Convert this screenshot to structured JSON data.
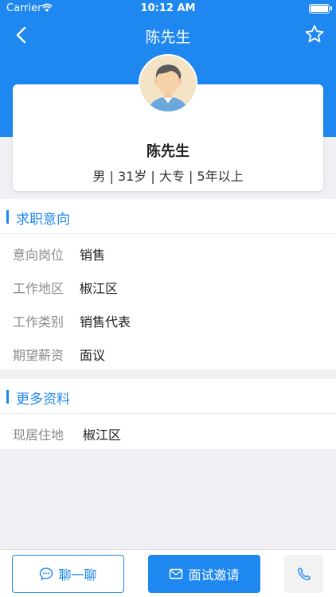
{
  "status_bar": {
    "carrier": "Carrier",
    "time": "10:12 AM"
  },
  "nav": {
    "title": "陈先生",
    "back_icon": "chevron-left-icon",
    "favorite_icon": "star-icon"
  },
  "profile": {
    "name": "陈先生",
    "meta": "男 | 31岁 | 大专 | 5年以上",
    "avatar_icon": "male-avatar-icon"
  },
  "job_intent": {
    "title": "求职意向",
    "rows": [
      {
        "label": "意向岗位",
        "value": "销售"
      },
      {
        "label": "工作地区",
        "value": "椒江区"
      },
      {
        "label": "工作类别",
        "value": "销售代表"
      },
      {
        "label": "期望薪资",
        "value": "面议"
      }
    ]
  },
  "more_info": {
    "title": "更多资料",
    "rows": [
      {
        "label": "现居住地",
        "value": "椒江区"
      }
    ]
  },
  "actions": {
    "chat_label": "聊一聊",
    "invite_label": "面试邀请",
    "phone_icon": "phone-icon"
  },
  "colors": {
    "accent": "#1e88f0",
    "background": "#efeff4",
    "label_gray": "#8a8a8a"
  }
}
